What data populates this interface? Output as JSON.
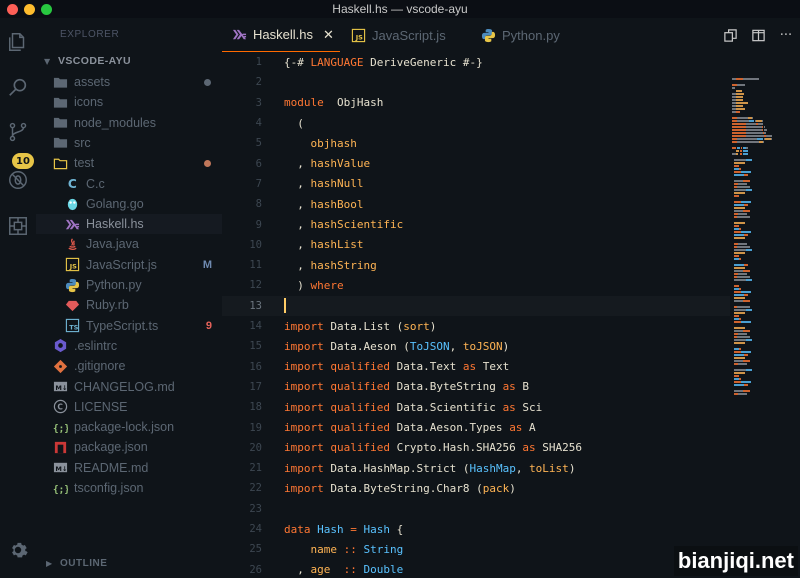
{
  "window": {
    "title": "Haskell.hs — vscode-ayu"
  },
  "activity": {
    "badge": "10"
  },
  "sidebar": {
    "explorer_label": "EXPLORER",
    "workspace": "VSCODE-AYU",
    "outline": "OUTLINE",
    "items": [
      {
        "name": "assets",
        "icon": "folder",
        "depth": 0,
        "dot": "#5c6773"
      },
      {
        "name": "icons",
        "icon": "folder",
        "depth": 0
      },
      {
        "name": "node_modules",
        "icon": "folder",
        "depth": 0
      },
      {
        "name": "src",
        "icon": "folder",
        "depth": 0
      },
      {
        "name": "test",
        "icon": "folder-open",
        "depth": 0,
        "dot": "#c0775a"
      },
      {
        "name": "C.c",
        "icon": "c",
        "depth": 1
      },
      {
        "name": "Golang.go",
        "icon": "go",
        "depth": 1
      },
      {
        "name": "Haskell.hs",
        "icon": "haskell",
        "depth": 1,
        "selected": true
      },
      {
        "name": "Java.java",
        "icon": "java",
        "depth": 1
      },
      {
        "name": "JavaScript.js",
        "icon": "js",
        "depth": 1,
        "status": "M",
        "status_color": "#6f8ab0"
      },
      {
        "name": "Python.py",
        "icon": "python",
        "depth": 1
      },
      {
        "name": "Ruby.rb",
        "icon": "ruby",
        "depth": 1
      },
      {
        "name": "TypeScript.ts",
        "icon": "ts",
        "depth": 1,
        "status": "9",
        "status_color": "#e5625a"
      },
      {
        "name": ".eslintrc",
        "icon": "eslint",
        "depth": 0
      },
      {
        "name": ".gitignore",
        "icon": "git",
        "depth": 0
      },
      {
        "name": "CHANGELOG.md",
        "icon": "markdown",
        "depth": 0
      },
      {
        "name": "LICENSE",
        "icon": "license",
        "depth": 0
      },
      {
        "name": "package-lock.json",
        "icon": "json",
        "depth": 0
      },
      {
        "name": "package.json",
        "icon": "npm",
        "depth": 0
      },
      {
        "name": "README.md",
        "icon": "markdown",
        "depth": 0
      },
      {
        "name": "tsconfig.json",
        "icon": "json",
        "depth": 0
      }
    ]
  },
  "tabs": [
    {
      "label": "Haskell.hs",
      "icon": "haskell",
      "active": true
    },
    {
      "label": "JavaScript.js",
      "icon": "js"
    },
    {
      "label": "Python.py",
      "icon": "python"
    }
  ],
  "editor": {
    "current_line": 13,
    "lines": [
      {
        "n": "1",
        "t": [
          [
            "cmt",
            "{-# "
          ],
          [
            "kw",
            "LANGUAGE"
          ],
          [
            "cmt",
            " DeriveGeneric #-}"
          ]
        ]
      },
      {
        "n": "2",
        "t": []
      },
      {
        "n": "3",
        "t": [
          [
            "kw",
            "module"
          ],
          [
            "",
            "  ObjHash"
          ]
        ]
      },
      {
        "n": "4",
        "t": [
          [
            "",
            "  ("
          ]
        ]
      },
      {
        "n": "5",
        "t": [
          [
            "",
            "    "
          ],
          [
            "pr",
            "objhash"
          ]
        ]
      },
      {
        "n": "6",
        "t": [
          [
            "",
            "  , "
          ],
          [
            "pr",
            "hashValue"
          ]
        ]
      },
      {
        "n": "7",
        "t": [
          [
            "",
            "  , "
          ],
          [
            "pr",
            "hashNull"
          ]
        ]
      },
      {
        "n": "8",
        "t": [
          [
            "",
            "  , "
          ],
          [
            "pr",
            "hashBool"
          ]
        ]
      },
      {
        "n": "9",
        "t": [
          [
            "",
            "  , "
          ],
          [
            "pr",
            "hashScientific"
          ]
        ]
      },
      {
        "n": "10",
        "t": [
          [
            "",
            "  , "
          ],
          [
            "pr",
            "hashList"
          ]
        ]
      },
      {
        "n": "11",
        "t": [
          [
            "",
            "  , "
          ],
          [
            "pr",
            "hashString"
          ]
        ]
      },
      {
        "n": "12",
        "t": [
          [
            "",
            "  ) "
          ],
          [
            "kw",
            "where"
          ]
        ]
      },
      {
        "n": "13",
        "t": []
      },
      {
        "n": "14",
        "t": [
          [
            "kw",
            "import"
          ],
          [
            "",
            " Data.List ("
          ],
          [
            "pr",
            "sort"
          ],
          [
            "",
            ")"
          ]
        ]
      },
      {
        "n": "15",
        "t": [
          [
            "kw",
            "import"
          ],
          [
            "",
            " Data.Aeson ("
          ],
          [
            "ty",
            "ToJSON"
          ],
          [
            "",
            ", "
          ],
          [
            "pr",
            "toJSON"
          ],
          [
            "",
            ")"
          ]
        ]
      },
      {
        "n": "16",
        "t": [
          [
            "kw",
            "import qualified"
          ],
          [
            "",
            " Data.Text "
          ],
          [
            "kw",
            "as"
          ],
          [
            "",
            " Text"
          ]
        ]
      },
      {
        "n": "17",
        "t": [
          [
            "kw",
            "import qualified"
          ],
          [
            "",
            " Data.ByteString "
          ],
          [
            "kw",
            "as"
          ],
          [
            "",
            " B"
          ]
        ]
      },
      {
        "n": "18",
        "t": [
          [
            "kw",
            "import qualified"
          ],
          [
            "",
            " Data.Scientific "
          ],
          [
            "kw",
            "as"
          ],
          [
            "",
            " Sci"
          ]
        ]
      },
      {
        "n": "19",
        "t": [
          [
            "kw",
            "import qualified"
          ],
          [
            "",
            " Data.Aeson.Types "
          ],
          [
            "kw",
            "as"
          ],
          [
            "",
            " A"
          ]
        ]
      },
      {
        "n": "20",
        "t": [
          [
            "kw",
            "import qualified"
          ],
          [
            "",
            " Crypto.Hash.SHA256 "
          ],
          [
            "kw",
            "as"
          ],
          [
            "",
            " SHA256"
          ]
        ]
      },
      {
        "n": "21",
        "t": [
          [
            "kw",
            "import"
          ],
          [
            "",
            " Data.HashMap.Strict ("
          ],
          [
            "ty",
            "HashMap"
          ],
          [
            "",
            ", "
          ],
          [
            "pr",
            "toList"
          ],
          [
            "",
            ")"
          ]
        ]
      },
      {
        "n": "22",
        "t": [
          [
            "kw",
            "import"
          ],
          [
            "",
            " Data.ByteString.Char8 ("
          ],
          [
            "pr",
            "pack"
          ],
          [
            "",
            ")"
          ]
        ]
      },
      {
        "n": "23",
        "t": []
      },
      {
        "n": "24",
        "t": [
          [
            "kw",
            "data"
          ],
          [
            "",
            " "
          ],
          [
            "ty",
            "Hash"
          ],
          [
            "",
            " "
          ],
          [
            "kw",
            "="
          ],
          [
            "",
            " "
          ],
          [
            "ty",
            "Hash"
          ],
          [
            "",
            " {"
          ]
        ]
      },
      {
        "n": "25",
        "t": [
          [
            "",
            "    "
          ],
          [
            "pr",
            "name"
          ],
          [
            "",
            " "
          ],
          [
            "kw",
            "::"
          ],
          [
            "",
            " "
          ],
          [
            "ty",
            "String"
          ]
        ]
      },
      {
        "n": "26",
        "t": [
          [
            "",
            "  , "
          ],
          [
            "pr",
            "age"
          ],
          [
            "",
            "  "
          ],
          [
            "kw",
            "::"
          ],
          [
            "",
            " "
          ],
          [
            "ty",
            "Double"
          ]
        ]
      }
    ]
  },
  "watermark": "bianjiqi.net"
}
